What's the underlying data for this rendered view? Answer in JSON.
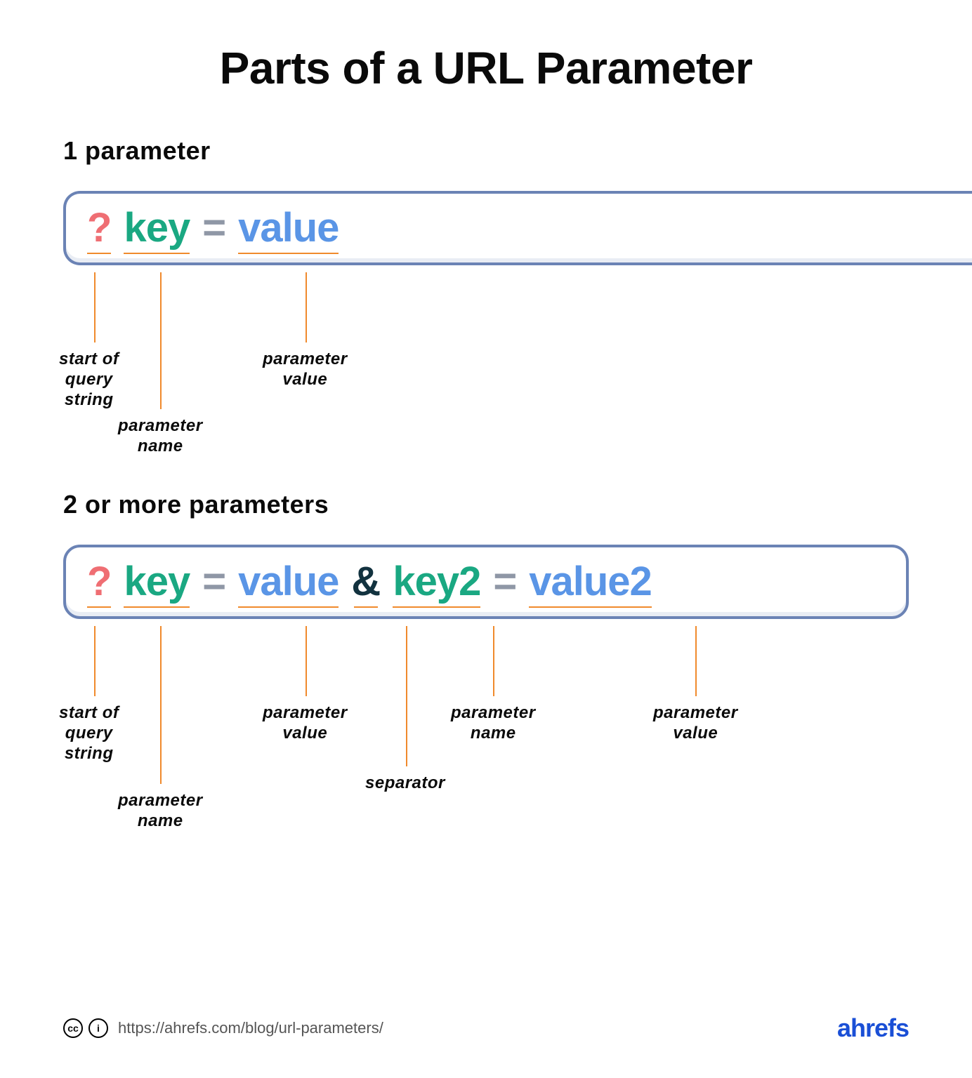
{
  "title": "Parts of a URL Parameter",
  "section1": {
    "heading": "1 parameter",
    "tokens": {
      "q": "?",
      "key": "key",
      "eq": "=",
      "value": "value"
    },
    "labels": {
      "start": "start of\nquery\nstring",
      "name": "parameter\nname",
      "value": "parameter\nvalue"
    }
  },
  "section2": {
    "heading": "2 or more parameters",
    "tokens": {
      "q": "?",
      "key1": "key",
      "eq1": "=",
      "val1": "value",
      "amp": "&",
      "key2": "key2",
      "eq2": "=",
      "val2": "value2"
    },
    "labels": {
      "start": "start of\nquery\nstring",
      "name1": "parameter\nname",
      "value1": "parameter\nvalue",
      "separator": "separator",
      "name2": "parameter\nname",
      "value2": "parameter\nvalue"
    }
  },
  "footer": {
    "source": "https://ahrefs.com/blog/url-parameters/",
    "brand": "ahrefs",
    "cc1": "cc",
    "cc2": "i"
  }
}
